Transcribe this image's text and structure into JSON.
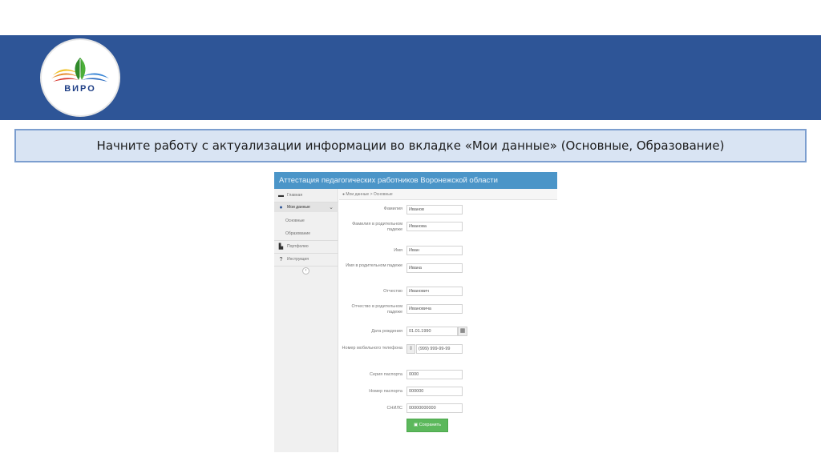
{
  "slide": {
    "logo_text": "ВИРО",
    "title": "Начните работу с актуализации информации во вкладке «Мои данные» (Основные, Образование)"
  },
  "app": {
    "header_title": "Аттестация педагогических работников Воронежской области",
    "breadcrumb": "Мои данные > Основные",
    "sidebar": {
      "top_item": "Главная",
      "my_data": "Мои данные",
      "sub_main": "Основные",
      "sub_education": "Образование",
      "portfolio": "Портфолио",
      "help": "Инструкция",
      "collapse_icon": "chevron-left-icon"
    },
    "form": {
      "fields": [
        {
          "label": "Фамилия",
          "value": "Иванов"
        },
        {
          "label": "Фамилия в родительном падеже",
          "value": "Иванова"
        },
        {
          "label": "Имя",
          "value": "Иван"
        },
        {
          "label": "Имя в родительном падеже",
          "value": "Ивана"
        },
        {
          "label": "Отчество",
          "value": "Иванович"
        },
        {
          "label": "Отчество в родительном падеже",
          "value": "Ивановича"
        },
        {
          "label": "Дата рождения",
          "value": "01.01.1990"
        },
        {
          "label": "Номер мобильного телефона",
          "value": "(999) 999-99-99"
        },
        {
          "label": "Серия паспорта",
          "value": "0000"
        },
        {
          "label": "Номер паспорта",
          "value": "000000"
        },
        {
          "label": "СНИЛС",
          "value": "00000000000"
        }
      ],
      "save_label": "Сохранить"
    },
    "colors": {
      "header": "#4b95c8",
      "save": "#5cb85c",
      "banner": "#2e5597"
    }
  }
}
